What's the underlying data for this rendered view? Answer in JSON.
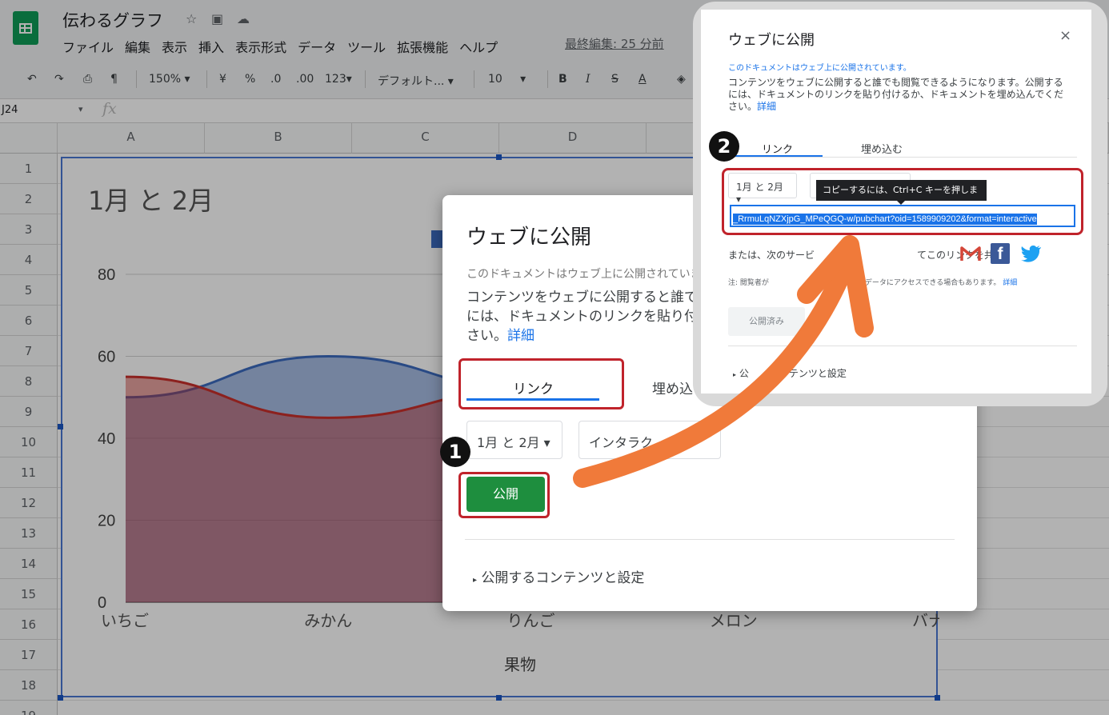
{
  "header": {
    "doc_title": "伝わるグラフ",
    "menu": [
      "ファイル",
      "編集",
      "表示",
      "挿入",
      "表示形式",
      "データ",
      "ツール",
      "拡張機能",
      "ヘルプ"
    ],
    "last_edit": "最終編集: 25 分前"
  },
  "toolbar": {
    "zoom": "150%",
    "currency": "¥",
    "percent": "%",
    "dec_less": ".0",
    "dec_more": ".00",
    "number_format": "123",
    "font": "デフォルト...",
    "font_size": "10",
    "bold": "B",
    "italic": "I",
    "strike": "S",
    "text_color": "A"
  },
  "formula_bar": {
    "cell_ref": "J24",
    "fx": "fx"
  },
  "sheet": {
    "columns": [
      "A",
      "B",
      "C",
      "D"
    ],
    "rows": [
      "1",
      "2",
      "3",
      "4",
      "5",
      "6",
      "7",
      "8",
      "9",
      "10",
      "11",
      "12",
      "13",
      "14",
      "15",
      "16",
      "17",
      "18",
      "19"
    ]
  },
  "chart_data": {
    "type": "area",
    "title": "1月 と 2月",
    "xlabel": "果物",
    "ylabel": "",
    "categories": [
      "いちご",
      "みかん",
      "りんご",
      "メロン",
      "バナナ"
    ],
    "y_ticks": [
      "0",
      "20",
      "40",
      "60",
      "80"
    ],
    "ylim": [
      0,
      80
    ],
    "series": [
      {
        "values": [
          50,
          60,
          52
        ],
        "color": "#3b6bbf"
      },
      {
        "values": [
          55,
          45,
          52
        ],
        "color": "#c9302c"
      }
    ],
    "grid": true
  },
  "dialog1": {
    "title": "ウェブに公開",
    "status": "このドキュメントはウェブ上に公開されていませ",
    "desc": "コンテンツをウェブに公開すると誰で",
    "desc2": "には、ドキュメントのリンクを貼り付",
    "desc3": "さい。",
    "details_link": "詳細",
    "tab_link": "リンク",
    "tab_embed": "埋め込む",
    "select_sheet": "1月 と 2月",
    "select_format": "インタラク",
    "publish_button": "公開",
    "settings": "公開するコンテンツと設定"
  },
  "dialog2": {
    "title": "ウェブに公開",
    "close": "×",
    "status": "このドキュメントはウェブ上に公開されています。",
    "desc": "コンテンツをウェブに公開すると誰でも閲覧できるようになります。公開するには、ドキュメントのリンクを貼り付けるか、ドキュメントを埋め込んでください。",
    "details_link": "詳細",
    "tab_link": "リンク",
    "tab_embed": "埋め込む",
    "select_sheet": "1月 と 2月",
    "tooltip": "コピーするには、Ctrl+C キーを押します。",
    "url": "_RrmuLqNZXjpG_MPeQGQ-w/pubchart?oid=1589909202&format=interactive",
    "share_pre": "または、次のサービ",
    "share_post": "てこのリンクを共有:",
    "note_pre": "注: 閲覧者が",
    "note_post": "データにアクセスできる場合もあります。",
    "note_link": "詳細",
    "published_button": "公開済み",
    "settings_pre": "公",
    "settings_post": "コンテンツと設定"
  },
  "badges": {
    "one": "1",
    "two": "2"
  }
}
